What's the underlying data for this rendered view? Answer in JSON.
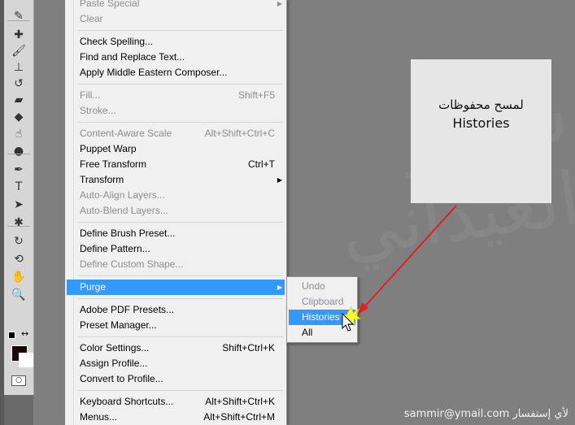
{
  "edit_menu": {
    "items": [
      {
        "label": "Paste Special",
        "disabled": true,
        "submenu": true
      },
      {
        "label": "Clear",
        "disabled": true
      },
      {
        "sep": true
      },
      {
        "label": "Check Spelling..."
      },
      {
        "label": "Find and Replace Text..."
      },
      {
        "label": "Apply Middle Eastern Composer..."
      },
      {
        "sep": true
      },
      {
        "label": "Fill...",
        "shortcut": "Shift+F5",
        "disabled": true
      },
      {
        "label": "Stroke...",
        "disabled": true
      },
      {
        "sep": true
      },
      {
        "label": "Content-Aware Scale",
        "shortcut": "Alt+Shift+Ctrl+C",
        "disabled": true
      },
      {
        "label": "Puppet Warp"
      },
      {
        "label": "Free Transform",
        "shortcut": "Ctrl+T"
      },
      {
        "label": "Transform",
        "submenu": true
      },
      {
        "label": "Auto-Align Layers...",
        "disabled": true
      },
      {
        "label": "Auto-Blend Layers...",
        "disabled": true
      },
      {
        "sep": true
      },
      {
        "label": "Define Brush Preset..."
      },
      {
        "label": "Define Pattern..."
      },
      {
        "label": "Define Custom Shape...",
        "disabled": true
      },
      {
        "sep": true
      },
      {
        "label": "Purge",
        "submenu": true,
        "selected": true
      },
      {
        "sep": true
      },
      {
        "label": "Adobe PDF Presets..."
      },
      {
        "label": "Preset Manager..."
      },
      {
        "sep": true
      },
      {
        "label": "Color Settings...",
        "shortcut": "Shift+Ctrl+K"
      },
      {
        "label": "Assign Profile..."
      },
      {
        "label": "Convert to Profile..."
      },
      {
        "sep": true
      },
      {
        "label": "Keyboard Shortcuts...",
        "shortcut": "Alt+Shift+Ctrl+K"
      },
      {
        "label": "Menus...",
        "shortcut": "Alt+Shift+Ctrl+M"
      }
    ]
  },
  "purge_submenu": {
    "items": [
      {
        "label": "Undo",
        "disabled": true
      },
      {
        "label": "Clipboard",
        "disabled": true
      },
      {
        "label": "Histories",
        "selected": true
      },
      {
        "label": "All"
      }
    ]
  },
  "tools": [
    "eyedropper-icon",
    "healing-brush-icon",
    "brush-icon",
    "clone-stamp-icon",
    "history-brush-icon",
    "eraser-icon",
    "paint-bucket-icon",
    "smudge-icon",
    "dodge-icon",
    "pen-icon",
    "type-icon",
    "path-selection-icon",
    "custom-shape-icon",
    "3d-rotate-icon",
    "3d-orbit-icon",
    "hand-icon",
    "zoom-icon"
  ],
  "tool_glyphs": [
    "✎",
    "✚",
    "🖌",
    "⊥",
    "↺",
    "▰",
    "◆",
    "☝",
    "●",
    "✒",
    "T",
    "➤",
    "✱",
    "↻",
    "⟲",
    "✋",
    "🔍"
  ],
  "callout": {
    "line1": "لمسح محفوظات",
    "line2": "Histories"
  },
  "footer": {
    "text": "sammir@ymail.com لأي إستفسار"
  },
  "watermark": "سمير العيداني",
  "colors": {
    "foreground": "#1a0505",
    "background": "#ffffff",
    "highlight": "#3399ff",
    "arrow": "#e02020"
  }
}
